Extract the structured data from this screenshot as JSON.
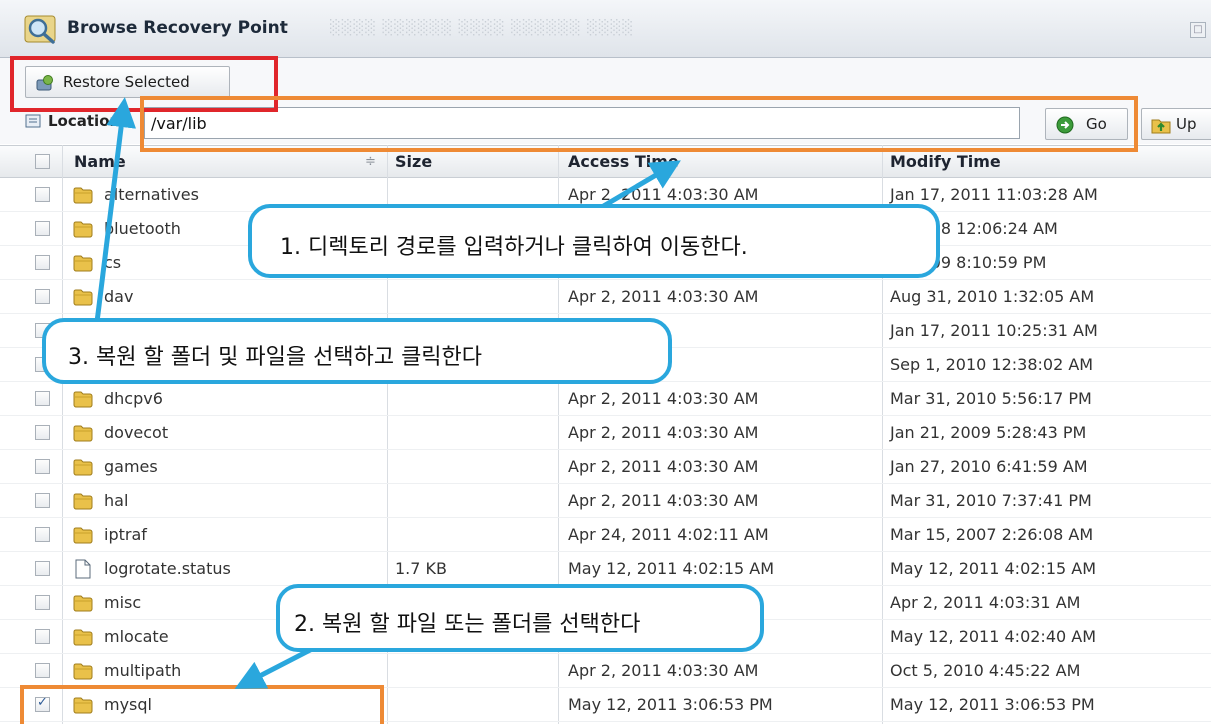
{
  "window": {
    "title": "Browse Recovery Point",
    "ghost_text": "░░░░ ░░░░░░ ░░░░ ░░░░░░ ░░░░",
    "maximize_label": "□"
  },
  "toolbar": {
    "restore_label": "Restore Selected"
  },
  "location": {
    "label": "Location",
    "value": "/var/lib",
    "go_label": "Go",
    "up_label": "Up"
  },
  "table": {
    "headers": {
      "name": "Name",
      "sort_indicator": "≑",
      "size": "Size",
      "access": "Access Time",
      "modify": "Modify Time"
    },
    "rows": [
      {
        "name": "alternatives",
        "icon": "folder-icon",
        "size": "",
        "access": "Apr 2, 2011 4:03:30 AM",
        "modify": "Jan 17, 2011 11:03:28 AM",
        "checked": false
      },
      {
        "name": "bluetooth",
        "icon": "folder-icon",
        "size": "",
        "access": "",
        "modify": "5, 2008 12:06:24 AM",
        "checked": false
      },
      {
        "name": "cs",
        "icon": "folder-icon",
        "size": "",
        "access": "",
        "modify": "6, 2009 8:10:59 PM",
        "checked": false
      },
      {
        "name": "dav",
        "icon": "folder-icon",
        "size": "",
        "access": "Apr 2, 2011 4:03:30 AM",
        "modify": "Aug 31, 2010 1:32:05 AM",
        "checked": false
      },
      {
        "name": "",
        "icon": "folder-icon",
        "size": "",
        "access": "4:03:30 AM",
        "modify": "Jan 17, 2011 10:25:31 AM",
        "checked": false
      },
      {
        "name": "",
        "icon": "folder-icon",
        "size": "",
        "access": "4:03:30 AM",
        "modify": "Sep 1, 2010 12:38:02 AM",
        "checked": false
      },
      {
        "name": "dhcpv6",
        "icon": "folder-icon",
        "size": "",
        "access": "Apr 2, 2011 4:03:30 AM",
        "modify": "Mar 31, 2010 5:56:17 PM",
        "checked": false
      },
      {
        "name": "dovecot",
        "icon": "folder-icon",
        "size": "",
        "access": "Apr 2, 2011 4:03:30 AM",
        "modify": "Jan 21, 2009 5:28:43 PM",
        "checked": false
      },
      {
        "name": "games",
        "icon": "folder-icon",
        "size": "",
        "access": "Apr 2, 2011 4:03:30 AM",
        "modify": "Jan 27, 2010 6:41:59 AM",
        "checked": false
      },
      {
        "name": "hal",
        "icon": "folder-icon",
        "size": "",
        "access": "Apr 2, 2011 4:03:30 AM",
        "modify": "Mar 31, 2010 7:37:41 PM",
        "checked": false
      },
      {
        "name": "iptraf",
        "icon": "folder-icon",
        "size": "",
        "access": "Apr 24, 2011 4:02:11 AM",
        "modify": "Mar 15, 2007 2:26:08 AM",
        "checked": false
      },
      {
        "name": "logrotate.status",
        "icon": "file-icon",
        "size": "1.7 KB",
        "access": "May 12, 2011 4:02:15 AM",
        "modify": "May 12, 2011 4:02:15 AM",
        "checked": false
      },
      {
        "name": "misc",
        "icon": "folder-icon",
        "size": "",
        "access": "AM",
        "modify": "Apr 2, 2011 4:03:31 AM",
        "checked": false
      },
      {
        "name": "mlocate",
        "icon": "folder-icon",
        "size": "",
        "access": "40 AM",
        "modify": "May 12, 2011 4:02:40 AM",
        "checked": false
      },
      {
        "name": "multipath",
        "icon": "folder-icon",
        "size": "",
        "access": "Apr 2, 2011 4:03:30 AM",
        "modify": "Oct 5, 2010 4:45:22 AM",
        "checked": false
      },
      {
        "name": "mysql",
        "icon": "folder-icon",
        "size": "",
        "access": "May 12, 2011 3:06:53 PM",
        "modify": "May 12, 2011 3:06:53 PM",
        "checked": true
      }
    ]
  },
  "annotations": {
    "step1": "1. 디렉토리 경로를 입력하거나 클릭하여 이동한다.",
    "step2": "2. 복원 할 파일 또는 폴더를 선택한다",
    "step3": "3. 복원 할 폴더 및 파일을 선택하고 클릭한다"
  },
  "colors": {
    "frame_red": "#e0262b",
    "frame_orange": "#ee8a35",
    "bubble_blue": "#2aa7dd",
    "folder_yellow": "#e9c14a"
  }
}
